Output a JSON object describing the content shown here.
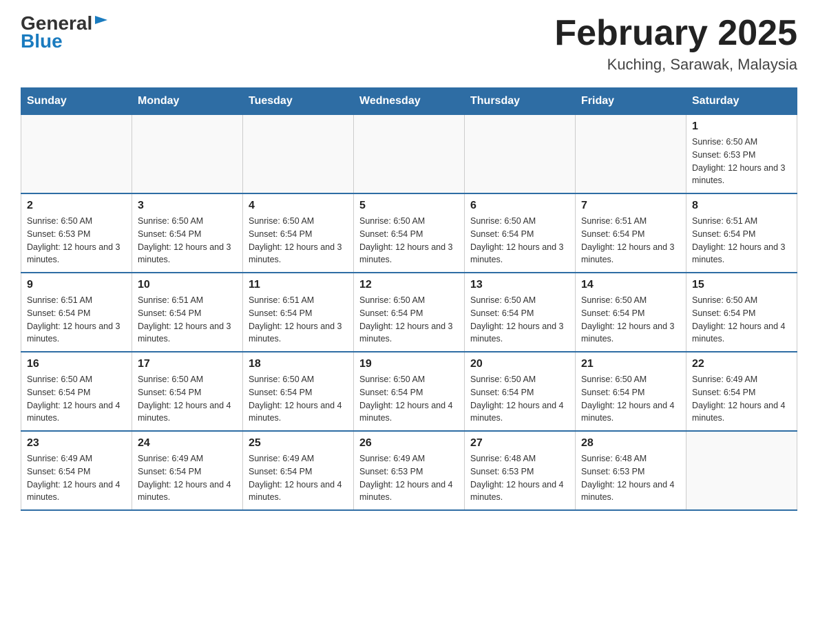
{
  "header": {
    "logo_general": "General",
    "logo_blue": "Blue",
    "title": "February 2025",
    "subtitle": "Kuching, Sarawak, Malaysia"
  },
  "days_of_week": [
    "Sunday",
    "Monday",
    "Tuesday",
    "Wednesday",
    "Thursday",
    "Friday",
    "Saturday"
  ],
  "weeks": [
    [
      {
        "day": "",
        "info": ""
      },
      {
        "day": "",
        "info": ""
      },
      {
        "day": "",
        "info": ""
      },
      {
        "day": "",
        "info": ""
      },
      {
        "day": "",
        "info": ""
      },
      {
        "day": "",
        "info": ""
      },
      {
        "day": "1",
        "info": "Sunrise: 6:50 AM\nSunset: 6:53 PM\nDaylight: 12 hours and 3 minutes."
      }
    ],
    [
      {
        "day": "2",
        "info": "Sunrise: 6:50 AM\nSunset: 6:53 PM\nDaylight: 12 hours and 3 minutes."
      },
      {
        "day": "3",
        "info": "Sunrise: 6:50 AM\nSunset: 6:54 PM\nDaylight: 12 hours and 3 minutes."
      },
      {
        "day": "4",
        "info": "Sunrise: 6:50 AM\nSunset: 6:54 PM\nDaylight: 12 hours and 3 minutes."
      },
      {
        "day": "5",
        "info": "Sunrise: 6:50 AM\nSunset: 6:54 PM\nDaylight: 12 hours and 3 minutes."
      },
      {
        "day": "6",
        "info": "Sunrise: 6:50 AM\nSunset: 6:54 PM\nDaylight: 12 hours and 3 minutes."
      },
      {
        "day": "7",
        "info": "Sunrise: 6:51 AM\nSunset: 6:54 PM\nDaylight: 12 hours and 3 minutes."
      },
      {
        "day": "8",
        "info": "Sunrise: 6:51 AM\nSunset: 6:54 PM\nDaylight: 12 hours and 3 minutes."
      }
    ],
    [
      {
        "day": "9",
        "info": "Sunrise: 6:51 AM\nSunset: 6:54 PM\nDaylight: 12 hours and 3 minutes."
      },
      {
        "day": "10",
        "info": "Sunrise: 6:51 AM\nSunset: 6:54 PM\nDaylight: 12 hours and 3 minutes."
      },
      {
        "day": "11",
        "info": "Sunrise: 6:51 AM\nSunset: 6:54 PM\nDaylight: 12 hours and 3 minutes."
      },
      {
        "day": "12",
        "info": "Sunrise: 6:50 AM\nSunset: 6:54 PM\nDaylight: 12 hours and 3 minutes."
      },
      {
        "day": "13",
        "info": "Sunrise: 6:50 AM\nSunset: 6:54 PM\nDaylight: 12 hours and 3 minutes."
      },
      {
        "day": "14",
        "info": "Sunrise: 6:50 AM\nSunset: 6:54 PM\nDaylight: 12 hours and 3 minutes."
      },
      {
        "day": "15",
        "info": "Sunrise: 6:50 AM\nSunset: 6:54 PM\nDaylight: 12 hours and 4 minutes."
      }
    ],
    [
      {
        "day": "16",
        "info": "Sunrise: 6:50 AM\nSunset: 6:54 PM\nDaylight: 12 hours and 4 minutes."
      },
      {
        "day": "17",
        "info": "Sunrise: 6:50 AM\nSunset: 6:54 PM\nDaylight: 12 hours and 4 minutes."
      },
      {
        "day": "18",
        "info": "Sunrise: 6:50 AM\nSunset: 6:54 PM\nDaylight: 12 hours and 4 minutes."
      },
      {
        "day": "19",
        "info": "Sunrise: 6:50 AM\nSunset: 6:54 PM\nDaylight: 12 hours and 4 minutes."
      },
      {
        "day": "20",
        "info": "Sunrise: 6:50 AM\nSunset: 6:54 PM\nDaylight: 12 hours and 4 minutes."
      },
      {
        "day": "21",
        "info": "Sunrise: 6:50 AM\nSunset: 6:54 PM\nDaylight: 12 hours and 4 minutes."
      },
      {
        "day": "22",
        "info": "Sunrise: 6:49 AM\nSunset: 6:54 PM\nDaylight: 12 hours and 4 minutes."
      }
    ],
    [
      {
        "day": "23",
        "info": "Sunrise: 6:49 AM\nSunset: 6:54 PM\nDaylight: 12 hours and 4 minutes."
      },
      {
        "day": "24",
        "info": "Sunrise: 6:49 AM\nSunset: 6:54 PM\nDaylight: 12 hours and 4 minutes."
      },
      {
        "day": "25",
        "info": "Sunrise: 6:49 AM\nSunset: 6:54 PM\nDaylight: 12 hours and 4 minutes."
      },
      {
        "day": "26",
        "info": "Sunrise: 6:49 AM\nSunset: 6:53 PM\nDaylight: 12 hours and 4 minutes."
      },
      {
        "day": "27",
        "info": "Sunrise: 6:48 AM\nSunset: 6:53 PM\nDaylight: 12 hours and 4 minutes."
      },
      {
        "day": "28",
        "info": "Sunrise: 6:48 AM\nSunset: 6:53 PM\nDaylight: 12 hours and 4 minutes."
      },
      {
        "day": "",
        "info": ""
      }
    ]
  ]
}
